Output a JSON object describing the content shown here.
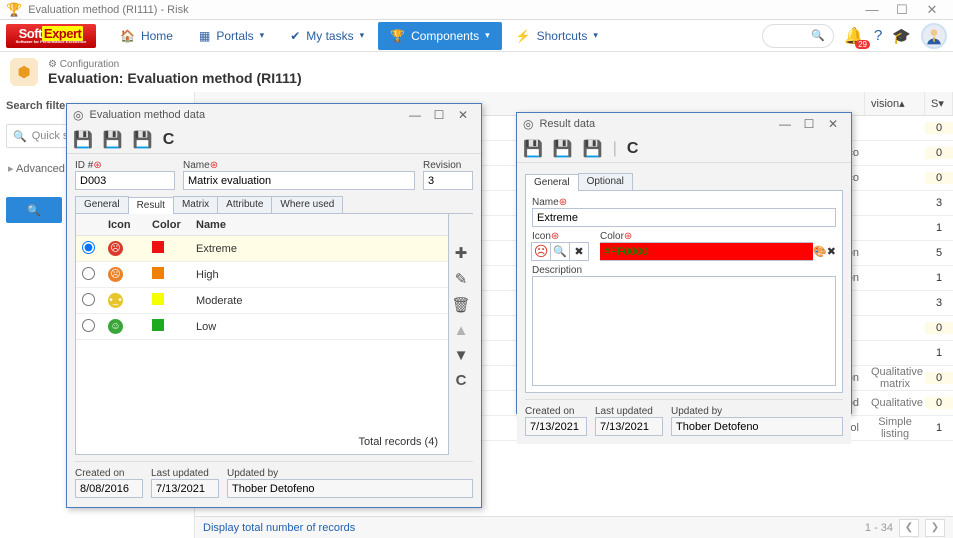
{
  "window": {
    "title": "Evaluation method (RI111) - Risk"
  },
  "nav": {
    "home": "Home",
    "portals": "Portals",
    "mytasks": "My tasks",
    "components": "Components",
    "shortcuts": "Shortcuts",
    "badge": "29"
  },
  "page": {
    "crumb": "Configuration",
    "title": "Evaluation: Evaluation method (RI111)"
  },
  "left": {
    "search": "Search filters",
    "quick": "Quick se",
    "advanced": "Advanced"
  },
  "grid": {
    "cols": {
      "revision": "vision",
      "s": "S"
    },
    "rows": [
      {
        "mid": "",
        "rev": "",
        "s": "0"
      },
      {
        "mid": "co",
        "rev": "",
        "s": "0"
      },
      {
        "mid": "co",
        "rev": "",
        "s": "0"
      },
      {
        "mid": "",
        "rev": "",
        "s": "3"
      },
      {
        "mid": "",
        "rev": "",
        "s": "1"
      },
      {
        "mid": "ation",
        "rev": "",
        "s": "5"
      },
      {
        "mid": "tion",
        "rev": "",
        "s": "1"
      },
      {
        "mid": "",
        "rev": "",
        "s": "3"
      },
      {
        "mid": "",
        "rev": "",
        "s": "0"
      },
      {
        "mid": "",
        "rev": "",
        "s": "1"
      },
      {
        "mid": "evaluation",
        "rev": "Qualitative matrix",
        "s": "0"
      },
      {
        "mid": "od",
        "rev": "Qualitative",
        "s": "0"
      },
      {
        "mid": "EffecControl    Effectiveness of control",
        "rev": "Simple listing",
        "s": "1"
      }
    ],
    "footer_link": "Display total number of records",
    "pager": "1 - 34"
  },
  "evalwin": {
    "title": "Evaluation method data",
    "id_label": "ID #",
    "id": "D003",
    "name_label": "Name",
    "name": "Matrix evaluation",
    "rev_label": "Revision",
    "rev": "3",
    "tabs": [
      "General",
      "Result",
      "Matrix",
      "Attribute",
      "Where used"
    ],
    "cols": {
      "icon": "Icon",
      "color": "Color",
      "name": "Name"
    },
    "results": [
      {
        "name": "Extreme",
        "face": "#d83a2b",
        "sw": "#e11",
        "sel": true,
        "mood": "☹"
      },
      {
        "name": "High",
        "face": "#e9822b",
        "sw": "#f08000",
        "mood": "☹"
      },
      {
        "name": "Moderate",
        "face": "#e7c52b",
        "sw": "#f6ff00",
        "mood": "•_•"
      },
      {
        "name": "Low",
        "face": "#3aa63a",
        "sw": "#1eaa1e",
        "mood": "☺"
      }
    ],
    "total": "Total records (4)",
    "created_on_l": "Created on",
    "created_on": "8/08/2016",
    "last_updated_l": "Last updated",
    "last_updated": "7/13/2021",
    "updated_by_l": "Updated by",
    "updated_by": "Thober Detofeno"
  },
  "resultwin": {
    "title": "Result data",
    "tabs": [
      "General",
      "Optional"
    ],
    "name_l": "Name",
    "name": "Extreme",
    "icon_l": "Icon",
    "color_l": "Color",
    "color": "#FF0000",
    "desc_l": "Description",
    "created_on_l": "Created on",
    "created_on": "7/13/2021",
    "last_updated_l": "Last updated",
    "last_updated": "7/13/2021",
    "updated_by_l": "Updated by",
    "updated_by": "Thober Detofeno"
  },
  "chart_data": {
    "type": "table",
    "note": "no chart present"
  }
}
